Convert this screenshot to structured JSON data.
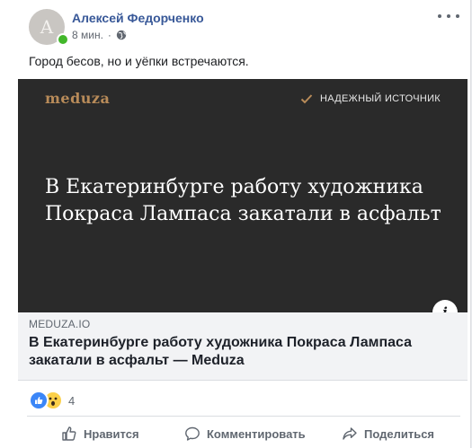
{
  "post": {
    "author": "Алексей Федорченко",
    "avatar_letter": "A",
    "time": "8 мин.",
    "separator": "·",
    "text": "Город бесов, но и уёпки встречаются."
  },
  "link": {
    "publisher_logo": "meduza",
    "trusted_label": "НАДЕЖНЫЙ ИСТОЧНИК",
    "headline": "В Екатеринбурге работу художника Покраса Лампаса закатали в асфальт",
    "domain": "MEDUZA.IO",
    "title": "В Екатеринбурге работу художника Покраса Лампаса закатали в асфальт — Meduza",
    "info_label": "i"
  },
  "reactions": {
    "count": "4",
    "types": [
      "like-icon",
      "wow-icon"
    ]
  },
  "actions": {
    "like": "Нравится",
    "comment": "Комментировать",
    "share": "Поделиться"
  },
  "colors": {
    "author_link": "#385898",
    "banner_bg": "#2a2a2a",
    "logo": "#b88b59",
    "online": "#42b72a",
    "like_blue": "#3b86f7",
    "wow_yellow": "#fbd04a"
  }
}
